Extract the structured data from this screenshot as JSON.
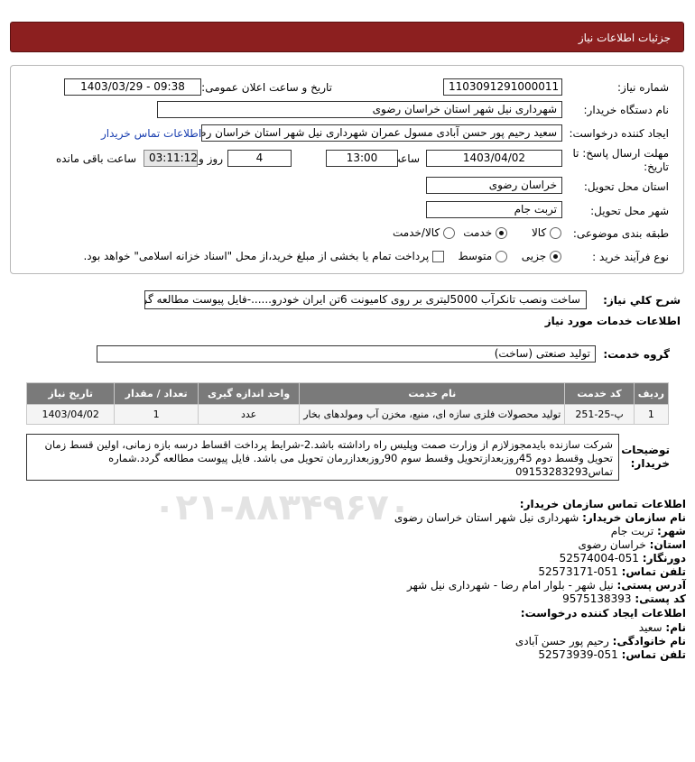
{
  "header": {
    "title": "جزئیات اطلاعات نیاز"
  },
  "form": {
    "need_number_label": "شماره نیاز:",
    "need_number": "1103091291000011",
    "announce_label": "تاریخ و ساعت اعلان عمومی:",
    "announce_value": "1403/03/29 - 09:38",
    "buyer_org_label": "نام دستگاه خریدار:",
    "buyer_org": "شهرداری نیل شهر استان خراسان رضوی",
    "creator_label": "ایجاد کننده درخواست:",
    "creator": "سعید رحیم پور حسن آبادی مسول عمران شهرداری نیل شهر استان خراسان رضوی",
    "contact_link": "اطلاعات تماس خریدار",
    "deadline_label_1": "مهلت ارسال پاسخ: تا",
    "deadline_label_2": "تاریخ:",
    "deadline_date": "1403/04/02",
    "time_label": "ساعت",
    "deadline_time": "13:00",
    "days_value": "4",
    "days_label": "روز و",
    "remaining_time": "03:11:12",
    "remaining_label": "ساعت باقی مانده",
    "province_label": "استان محل تحویل:",
    "province": "خراسان رضوی",
    "city_label": "شهر محل تحویل:",
    "city": "تربت جام",
    "category_label": "طبقه بندی موضوعی:",
    "category_options": [
      "کالا",
      "خدمت",
      "کالا/خدمت"
    ],
    "category_selected": "خدمت",
    "process_label": "نوع فرآیند خرید :",
    "process_options": [
      "جزیی",
      "متوسط"
    ],
    "process_selected": "جزیی",
    "treasury_note": "پرداخت تمام یا بخشی از مبلغ خرید،از محل \"اسناد خزانه اسلامی\" خواهد بود."
  },
  "description": {
    "label": "شرح کلي نياز:",
    "text": "ساخت ونصب تانکرآب 5000لیتری بر روی کامیونت 6تن ایران خودرو......-فایل پیوست مطالعه گردد."
  },
  "services": {
    "section_title": "اطلاعات خدمات مورد نياز",
    "group_label": "گروه خدمت:",
    "group_value": "تولید صنعتی (ساخت)",
    "columns": [
      "ردیف",
      "کد خدمت",
      "نام خدمت",
      "واحد اندازه گیری",
      "تعداد / مقدار",
      "تاریخ نیاز"
    ],
    "rows": [
      [
        "1",
        "پ-25-251",
        "تولید محصولات فلزی سازه ای، منبع، مخزن آب ومولدهای بخار",
        "عدد",
        "1",
        "1403/04/02"
      ]
    ]
  },
  "buyer_notes": {
    "label_1": "توضیحات",
    "label_2": "خریدار:",
    "text": "شرکت سازنده بایدمجوزلازم از وزارت صمت وپلیس راه راداشته باشد.2-شرایط پرداخت اقساط درسه بازه زمانی، اولین قسط زمان تحویل وقسط دوم 45روزبعدازتحویل وقسط سوم 90روزبعدازرمان تحویل می باشد. فایل پیوست مطالعه گردد.شماره تماس09153283293"
  },
  "buyer_contact": {
    "title": "اطلاعات تماس سازمان خریدار:",
    "org_label": "نام سازمان خریدار:",
    "org": "شهرداری نیل شهر استان خراسان رضوی",
    "city_label": "شهر:",
    "city": "تربت جام",
    "province_label": "استان:",
    "province": "خراسان رضوی",
    "fax_label": "دورنگار:",
    "fax": "051-52574004",
    "phone_label": "تلفن تماس:",
    "phone": "051-52573171",
    "address_label": "آدرس پستی:",
    "address": "نیل شهر - بلوار امام رضا - شهرداری نیل شهر",
    "postal_label": "کد پستی:",
    "postal": "9575138393"
  },
  "creator_contact": {
    "title": "اطلاعات ایجاد کننده درخواست:",
    "name_label": "نام:",
    "name": "سعید",
    "family_label": "نام خانوادگی:",
    "family": "رحیم پور حسن آبادی",
    "phone_label": "تلفن تماس:",
    "phone": "051-52573939"
  },
  "watermark": "۰۲۱-۸۸۳۴۹۶۷۰"
}
